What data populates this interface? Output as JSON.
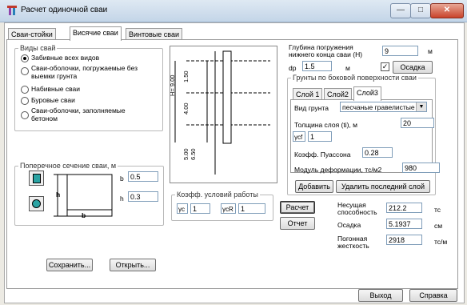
{
  "window": {
    "title": "Расчет одиночной сваи",
    "min": "—",
    "max": "□",
    "close": "✕"
  },
  "tabs": [
    {
      "label": "Сваи-стойки"
    },
    {
      "label": "Висячие сваи"
    },
    {
      "label": "Винтовые сваи"
    }
  ],
  "pile_types": {
    "legend": "Виды свай",
    "options": [
      "Забивные всех видов",
      "Сваи-оболочки, погружаемые без выемки грунта",
      "Набивные сваи",
      "Буровые сваи",
      "Сваи-оболочки, заполняемые бетоном"
    ],
    "selected": 0
  },
  "cross_section": {
    "legend": "Поперечное сечение сваи, м",
    "b_label": "b",
    "b_value": "0.5",
    "h_label": "h",
    "h_value": "0.3",
    "fig_h": "h",
    "fig_b": "b"
  },
  "diagram": {
    "h_label": "H= 9.00",
    "d1": "1.50",
    "d2": "4.00",
    "d3": "5.00",
    "d4": "6.50"
  },
  "work_coef": {
    "legend": "Коэфф. условий работы",
    "yc_label": "γc",
    "yc_value": "1",
    "ycr_label": "γcR",
    "ycr_value": "1"
  },
  "depth": {
    "label_line1": "Глубина погружения",
    "label_line2": "нижнего конца сваи (H)",
    "value": "9",
    "unit": "м"
  },
  "dp": {
    "label": "dp",
    "value": "1.5",
    "unit": "м",
    "checkbox_mark": "✓",
    "settle_button": "Осадка"
  },
  "soils": {
    "legend": "Грунты по боковой поверхности сваи",
    "layer_tabs": [
      "Слой 1",
      "Слой2",
      "Слой3"
    ],
    "soil_type_label": "Вид грунта",
    "soil_type_value": "песчаные гравелистые (",
    "thickness_label": "Толщина слоя (ti), м",
    "thickness_value": "20",
    "ycf_label": "γcf",
    "ycf_value": "1",
    "poisson_label": "Коэфф. Пуассона",
    "poisson_value": "0.28",
    "modulus_label": "Модуль деформации, тс/м2",
    "modulus_value": "980",
    "add_button": "Добавить",
    "delete_button": "Удалить последний слой"
  },
  "results": {
    "calc_button": "Расчет",
    "report_button": "Отчет",
    "capacity_label_1": "Несущая",
    "capacity_label_2": "способность",
    "capacity_value": "212.2",
    "capacity_unit": "тс",
    "settle_label": "Осадка",
    "settle_value": "5.1937",
    "settle_unit": "см",
    "stiff_label_1": "Погонная",
    "stiff_label_2": "жесткость",
    "stiff_value": "2918",
    "stiff_unit": "тс/м"
  },
  "footer": {
    "save": "Сохранить...",
    "open": "Открыть...",
    "exit": "Выход",
    "help": "Справка"
  }
}
